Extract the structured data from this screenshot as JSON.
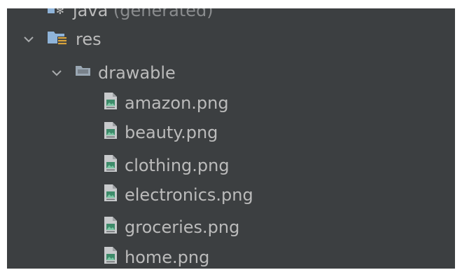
{
  "tree": {
    "generated_folder": {
      "name": "java",
      "suffix": " (generated)"
    },
    "res": {
      "label": "res"
    },
    "drawable": {
      "label": "drawable"
    },
    "files": [
      "amazon.png",
      "beauty.png",
      "clothing.png",
      "electronics.png",
      "groceries.png",
      "home.png"
    ]
  },
  "icons": {
    "expanded": "chevron-down-icon",
    "resource_folder": "resource-folder-icon",
    "folder": "folder-icon",
    "image_file": "image-file-icon",
    "generated": "generated-java-folder-icon"
  },
  "colors": {
    "panel_bg": "#3c3f41",
    "text": "#bbbbbb",
    "dim_text": "#8a8c8e",
    "folder_blue": "#8fb4d9",
    "res_yellow": "#d8a33b"
  }
}
